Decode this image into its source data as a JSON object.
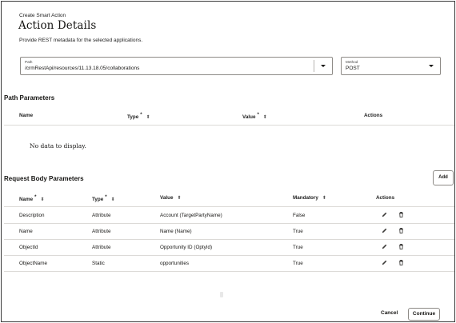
{
  "header": {
    "subtitle": "Create Smart Action",
    "title": "Action Details",
    "description": "Provide REST metadata for the selected applications."
  },
  "path_field": {
    "label": "Path",
    "value": "/crmRestApi/resources/11.13.18.05/collaborations"
  },
  "method_field": {
    "label": "Method",
    "value": "POST"
  },
  "path_parameters": {
    "title": "Path Parameters",
    "columns": {
      "name": "Name",
      "type": "Type",
      "value": "Value",
      "actions": "Actions"
    },
    "empty_text": "No data to display."
  },
  "request_body": {
    "title": "Request Body Parameters",
    "add_label": "Add",
    "columns": {
      "name": "Name",
      "type": "Type",
      "value": "Value",
      "mandatory": "Mandatory",
      "actions": "Actions"
    },
    "rows": [
      {
        "name": "Description",
        "type": "Attribute",
        "value": "Account (TargetPartyName)",
        "mandatory": "False"
      },
      {
        "name": "Name",
        "type": "Attribute",
        "value": "Name (Name)",
        "mandatory": "True"
      },
      {
        "name": "ObjectId",
        "type": "Attribute",
        "value": "Opportunity ID (OptyId)",
        "mandatory": "True"
      },
      {
        "name": "ObjectName",
        "type": "Static",
        "value": "opportunities",
        "mandatory": "True"
      }
    ]
  },
  "footer": {
    "cancel_label": "Cancel",
    "continue_label": "Continue"
  },
  "icons": {
    "required": "asterisk",
    "sort": "sort-arrows-icon",
    "edit": "pencil-icon",
    "delete": "trash-icon",
    "dropdown": "chevron-down-icon"
  },
  "colors": {
    "border": "#8d8a86",
    "divider": "#dcdad7",
    "text": "#161513"
  }
}
